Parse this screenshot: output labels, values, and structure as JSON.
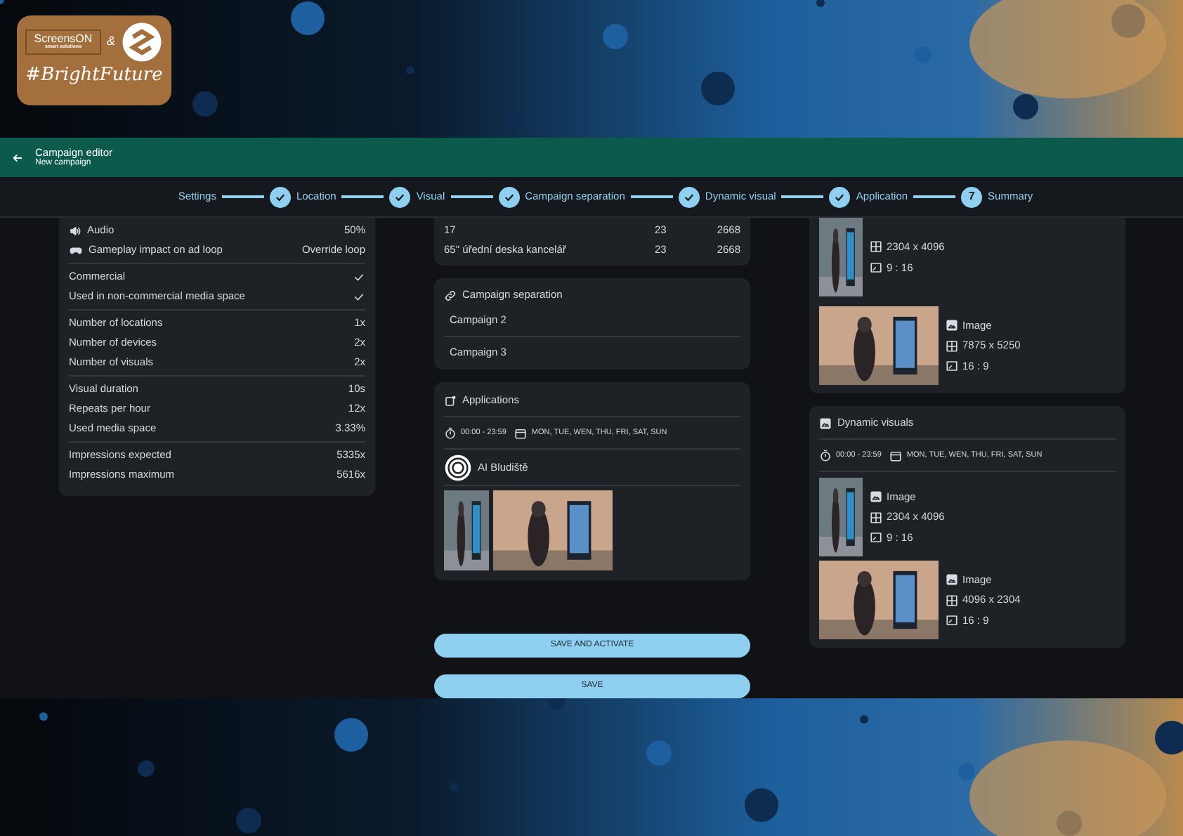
{
  "logo": {
    "brand": "ScreensON",
    "tagline": "smart solutions",
    "joiner": "&",
    "hashtag": "#BrightFuture"
  },
  "header": {
    "title": "Campaign editor",
    "subtitle": "New campaign"
  },
  "steps": [
    {
      "label": "Settings",
      "kind": "plain"
    },
    {
      "label": "Location",
      "kind": "done"
    },
    {
      "label": "Visual",
      "kind": "done"
    },
    {
      "label": "Campaign separation",
      "kind": "done"
    },
    {
      "label": "Dynamic visual",
      "kind": "done"
    },
    {
      "label": "Application",
      "kind": "done"
    },
    {
      "label": "Summary",
      "kind": "number",
      "number": "7"
    }
  ],
  "summary": {
    "groups": [
      [
        {
          "label": "Audio",
          "value": "50%",
          "kind": "audio"
        },
        {
          "label": "Gameplay impact on ad loop",
          "value": "Override loop",
          "kind": "gamepad"
        }
      ],
      [
        {
          "label": "Commercial",
          "checked": true,
          "kind": "check"
        },
        {
          "label": "Used in non-commercial media space",
          "checked": true,
          "kind": "check"
        }
      ],
      [
        {
          "label": "Number of locations",
          "value": "1x",
          "kind": "text"
        },
        {
          "label": "Number of devices",
          "value": "2x",
          "kind": "text"
        },
        {
          "label": "Number of visuals",
          "value": "2x",
          "kind": "text"
        }
      ],
      [
        {
          "label": "Visual duration",
          "value": "10s",
          "kind": "text"
        },
        {
          "label": "Repeats per hour",
          "value": "12x",
          "kind": "text"
        },
        {
          "label": "Used media space",
          "value": "3.33%",
          "kind": "text"
        }
      ],
      [
        {
          "label": "Impressions expected",
          "value": "5335x",
          "kind": "text"
        },
        {
          "label": "Impressions maximum",
          "value": "5616x",
          "kind": "text"
        }
      ]
    ]
  },
  "devices": {
    "rows": [
      {
        "name": "17",
        "col_2": "23",
        "col_3": "2668"
      },
      {
        "name": "65\" úřední deska kancelář",
        "col_2": "23",
        "col_3": "2668"
      }
    ]
  },
  "separation": {
    "title": "Campaign separation",
    "items": [
      "Campaign 2",
      "Campaign 3"
    ]
  },
  "applications": {
    "title": "Applications",
    "time": "00:00 - 23:59",
    "days": "MON, TUE, WEN, THU, FRI, SAT, SUN",
    "app": "AI Bludiště"
  },
  "visuals": {
    "items": [
      {
        "size": "2304 x 4096",
        "ratio": "9 : 16"
      },
      {
        "type": "Image",
        "size": "7875 x 5250",
        "ratio": "16 : 9"
      }
    ]
  },
  "dynamic": {
    "title": "Dynamic visuals",
    "time": "00:00 - 23:59",
    "days": "MON, TUE, WEN, THU, FRI, SAT, SUN",
    "items": [
      {
        "type": "Image",
        "size": "2304 x 4096",
        "ratio": "9 : 16"
      },
      {
        "type": "Image",
        "size": "4096 x 2304",
        "ratio": "16 : 9"
      }
    ]
  },
  "buttons": [
    "SAVE AND ACTIVATE",
    "SAVE"
  ]
}
